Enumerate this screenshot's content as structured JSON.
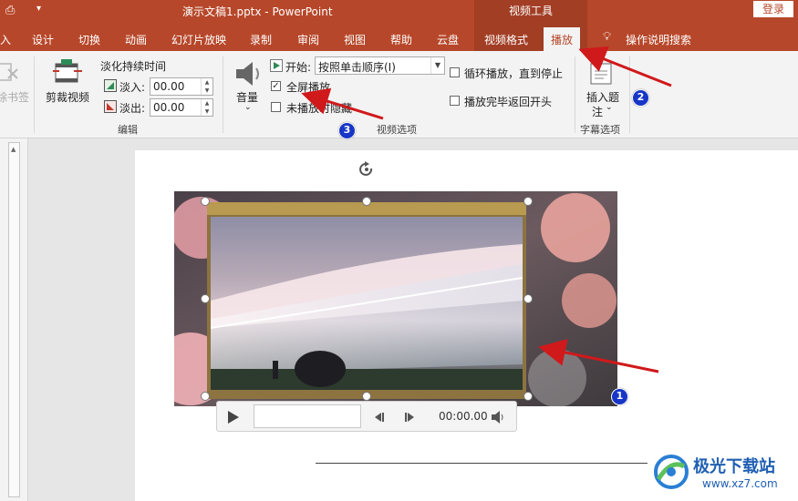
{
  "titlebar": {
    "doc_title": "演示文稿1.pptx  -  PowerPoint",
    "context_group": "视频工具",
    "login": "登录"
  },
  "tabs": [
    {
      "label": "入",
      "active": false
    },
    {
      "label": "设计",
      "active": false
    },
    {
      "label": "切换",
      "active": false
    },
    {
      "label": "动画",
      "active": false
    },
    {
      "label": "幻灯片放映",
      "active": false
    },
    {
      "label": "录制",
      "active": false
    },
    {
      "label": "审阅",
      "active": false
    },
    {
      "label": "视图",
      "active": false
    },
    {
      "label": "帮助",
      "active": false
    },
    {
      "label": "云盘",
      "active": false
    },
    {
      "label": "视频格式",
      "active": false
    },
    {
      "label": "播放",
      "active": true
    }
  ],
  "tell_me": "操作说明搜索",
  "ribbon": {
    "bookmark_remove": "除书签",
    "trim_video": "剪裁视频",
    "fade_duration": "淡化持续时间",
    "fade_in_label": "淡入:",
    "fade_in_value": "00.00",
    "fade_out_label": "淡出:",
    "fade_out_value": "00.00",
    "edit_group": "编辑",
    "volume": "音量",
    "start_label": "开始:",
    "start_value": "按照单击顺序(I)",
    "fullscreen": "全屏播放",
    "fullscreen_checked": true,
    "hide_not_playing": "未播放时隐藏",
    "hide_not_playing_checked": false,
    "loop": "循环播放，直到停止",
    "loop_checked": false,
    "rewind": "播放完毕返回开头",
    "rewind_checked": false,
    "video_options_group": "视频选项",
    "insert_caption_line1": "插入题",
    "insert_caption_line2": "注",
    "caption_options_group": "字幕选项"
  },
  "player": {
    "time": "00:00.00"
  },
  "badges": [
    "1",
    "2",
    "3"
  ],
  "watermark": {
    "name": "极光下载站",
    "url": "www.xz7.com"
  },
  "colors": {
    "accent": "#b7472a",
    "context": "#a23e24",
    "arrow": "#d0191b",
    "badge": "#1736c7"
  }
}
